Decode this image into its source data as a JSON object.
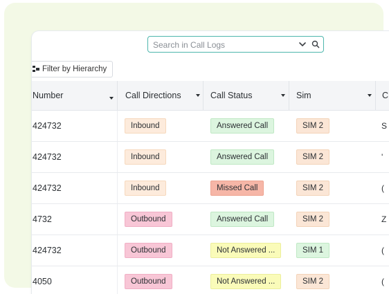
{
  "search": {
    "placeholder": "Search in Call Logs"
  },
  "toolbar": {
    "filter_label": "Filter by Hierarchy"
  },
  "table": {
    "columns": [
      {
        "label": "Number"
      },
      {
        "label": "Call Directions"
      },
      {
        "label": "Call Status"
      },
      {
        "label": "Sim"
      },
      {
        "label": "C"
      }
    ],
    "rows": [
      {
        "number": "424732",
        "direction": "Inbound",
        "status": "Answered Call",
        "sim": "SIM 2",
        "next": "S"
      },
      {
        "number": "424732",
        "direction": "Inbound",
        "status": "Answered Call",
        "sim": "SIM 2",
        "next": "'"
      },
      {
        "number": "424732",
        "direction": "Inbound",
        "status": "Missed Call",
        "sim": "SIM 2",
        "next": "("
      },
      {
        "number": "4732",
        "direction": "Outbound",
        "status": "Answered Call",
        "sim": "SIM 2",
        "next": "Z"
      },
      {
        "number": "424732",
        "direction": "Outbound",
        "status": "Not Answered ...",
        "sim": "SIM 1",
        "next": "("
      },
      {
        "number": "4050",
        "direction": "Outbound",
        "status": "Not Answered ...",
        "sim": "SIM 2",
        "next": "("
      }
    ]
  },
  "colors": {
    "backdrop": "#f3f9e6",
    "search_border": "#4db6ac",
    "inbound_bg": "#fdebdc",
    "outbound_bg": "#f8c6d6",
    "answered_bg": "#dcf5df",
    "missed_bg": "#f6b6a7",
    "not_answered_bg": "#fafbb9",
    "sim2_bg": "#fbe6d6",
    "sim1_bg": "#dcf5df"
  }
}
